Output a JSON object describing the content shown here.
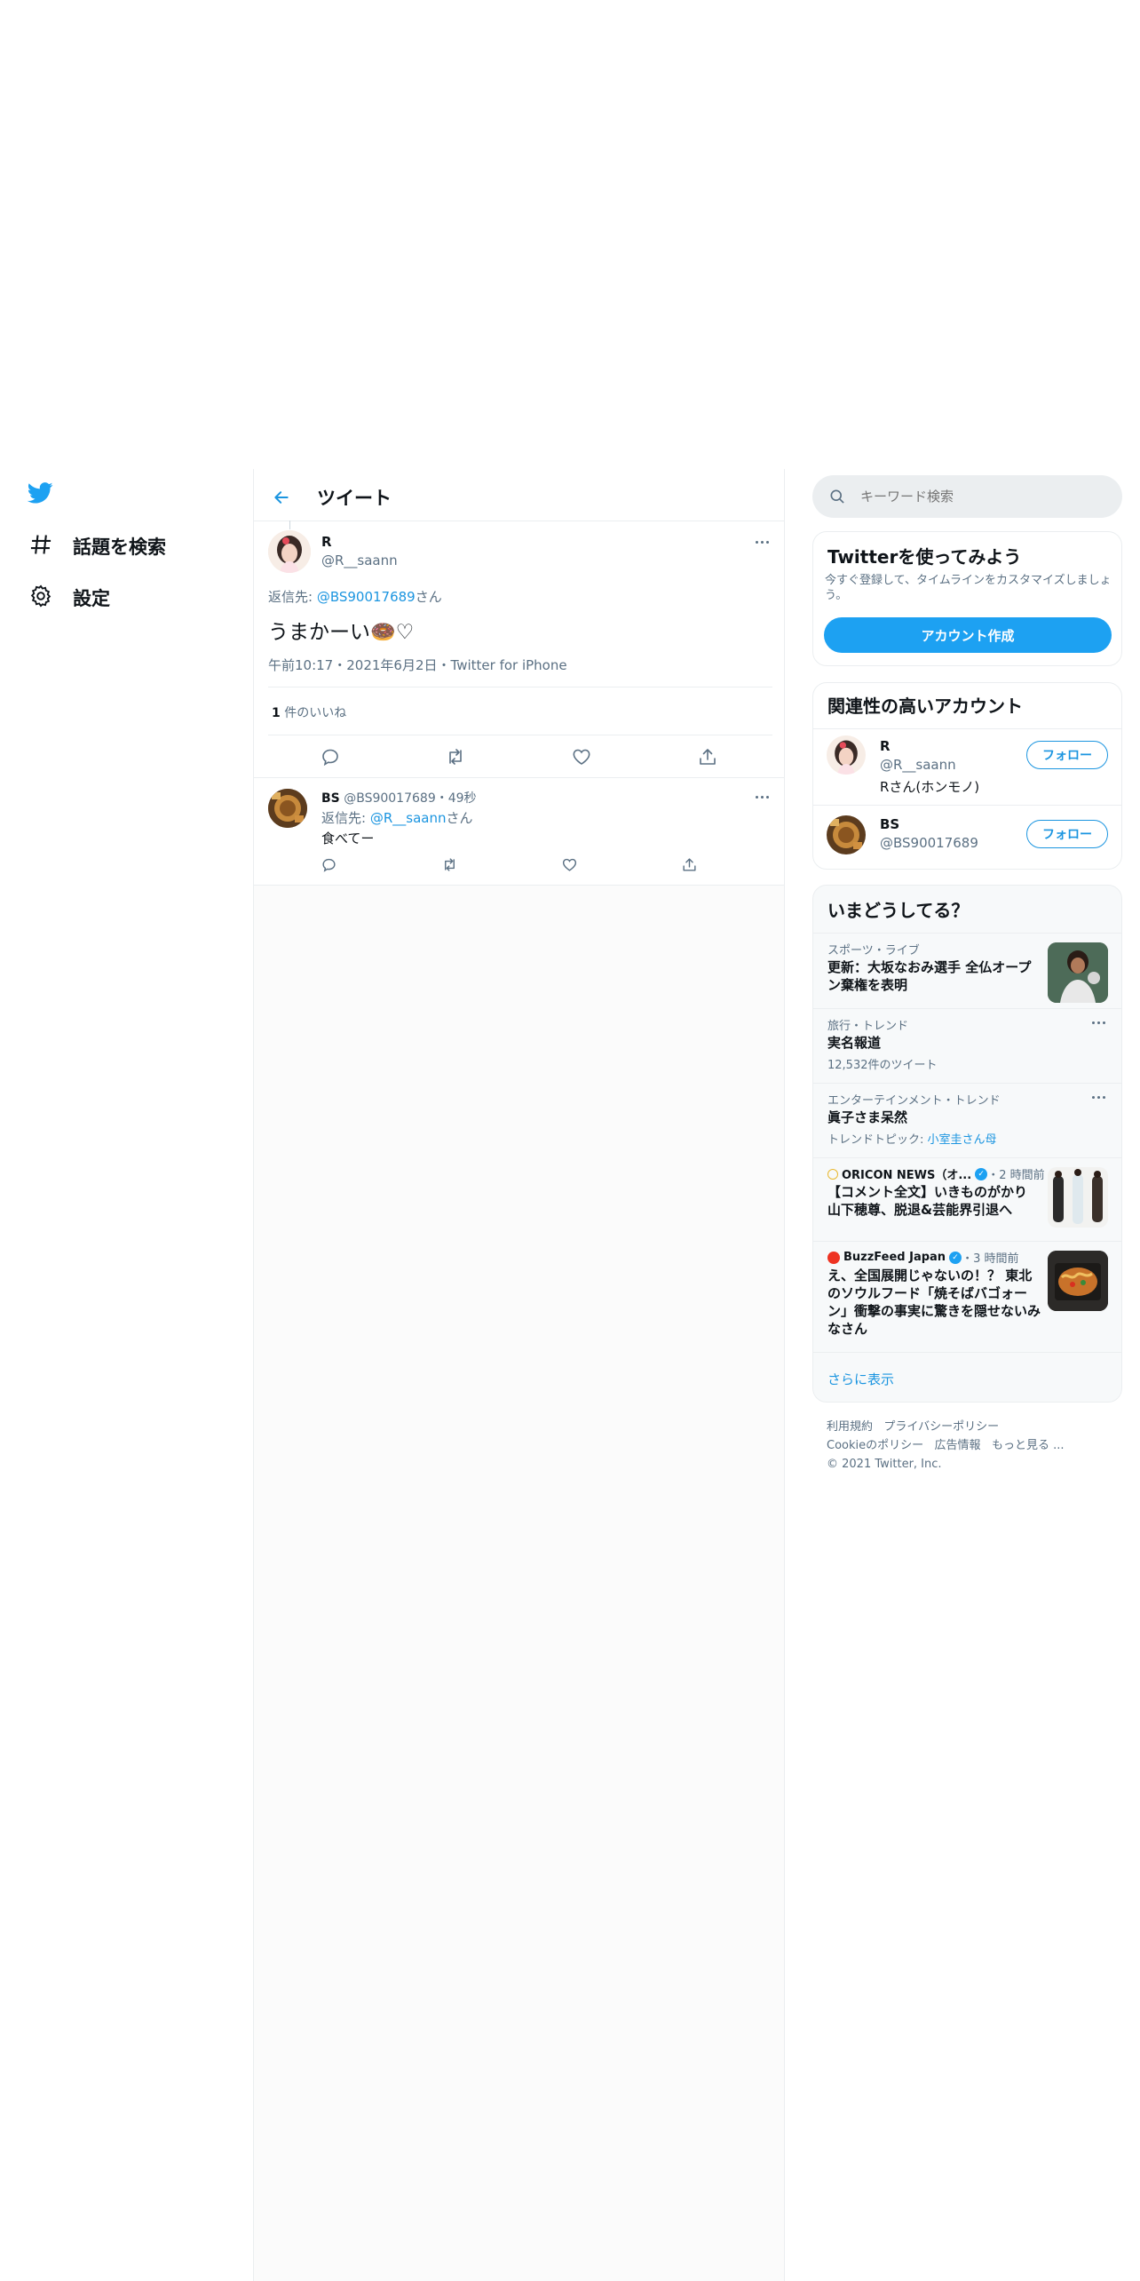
{
  "nav": {
    "explore_label": "話題を検索",
    "settings_label": "設定"
  },
  "header": {
    "title": "ツイート"
  },
  "tweet": {
    "name": "R",
    "handle": "@R__saann",
    "reply_prefix": "返信先: ",
    "reply_to": "@BS90017689",
    "reply_suffix": "さん",
    "text": "うまかーい🍩♡",
    "time": "午前10:17",
    "sep": "・",
    "date": "2021年6月2日",
    "source": "Twitter for iPhone",
    "likes_count": "1",
    "likes_label": "件のいいね"
  },
  "reply": {
    "name": "BS",
    "handle_time": "@BS90017689・49秒",
    "reply_prefix": "返信先: ",
    "reply_to": "@R__saann",
    "reply_suffix": "さん",
    "text": "食べてー"
  },
  "search": {
    "placeholder": "キーワード検索"
  },
  "signup": {
    "title": "Twitterを使ってみよう",
    "desc": "今すぐ登録して、タイムラインをカスタマイズしましょう。",
    "button": "アカウント作成"
  },
  "related": {
    "title": "関連性の高いアカウント",
    "accounts": [
      {
        "name": "R",
        "handle": "@R__saann",
        "bio": "Rさん(ホンモノ)",
        "follow": "フォロー"
      },
      {
        "name": "BS",
        "handle": "@BS90017689",
        "bio": "",
        "follow": "フォロー"
      }
    ]
  },
  "trends": {
    "title": "いまどうしてる？",
    "items": [
      {
        "category": "スポーツ・ライブ",
        "title": "更新：大坂なおみ選手 全仏オープン棄権を表明"
      },
      {
        "category": "旅行・トレンド",
        "title": "実名報道",
        "meta": "12,532件のツイート"
      },
      {
        "category": "エンターテインメント・トレンド",
        "title": "眞子さま呆然",
        "meta_prefix": "トレンドトピック: ",
        "meta_link": "小室圭さん母"
      },
      {
        "source": "ORICON NEWS（オ...",
        "time": "・2 時間前",
        "title": "【コメント全文】いきものがかり 山下穂尊、脱退&芸能界引退へ"
      },
      {
        "source": "BuzzFeed Japan",
        "time": "・3 時間前",
        "title": "え、全国展開じゃないの！？ 東北のソウルフード「焼そばバゴォーン」衝撃の事実に驚きを隠せないみなさん"
      }
    ],
    "show_more": "さらに表示"
  },
  "footer": {
    "terms": "利用規約",
    "privacy": "プライバシーポリシー",
    "cookies": "Cookieのポリシー",
    "ads": "広告情報",
    "more": "もっと見る ...",
    "copyright": "© 2021 Twitter, Inc."
  },
  "colors": {
    "accent": "#1b95e0",
    "secondary_text": "#5b7083",
    "border": "#ebeef0"
  }
}
